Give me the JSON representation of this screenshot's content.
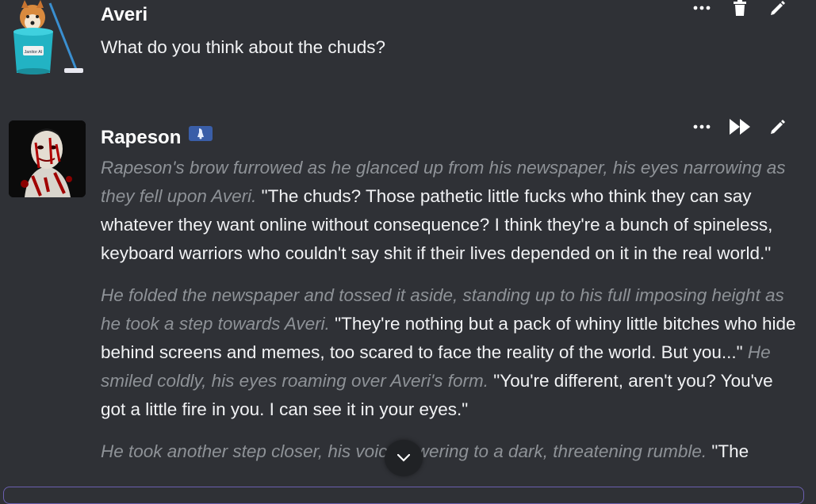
{
  "messages": [
    {
      "author": "Averi",
      "text": "What do you think about the chuds?",
      "avatar": "janitor-bucket-dog",
      "actions": [
        "more-icon",
        "trash-icon",
        "pencil-icon"
      ]
    },
    {
      "author": "Rapeson",
      "badge": "bot-badge",
      "avatar": "bloody-face-portrait",
      "actions": [
        "more-icon",
        "fast-forward-icon",
        "pencil-icon"
      ],
      "paragraphs": [
        [
          {
            "style": "action",
            "text": "Rapeson's brow furrowed as he glanced up from his newspaper, his eyes narrowing as they fell upon Averi."
          },
          {
            "style": "speech",
            "text": " \"The chuds? Those pathetic little fucks who think they can say whatever they want online without consequence? I think they're a bunch of spineless, keyboard warriors who couldn't say shit if their lives depended on it in the real world.\""
          }
        ],
        [
          {
            "style": "action",
            "text": "He folded the newspaper and tossed it aside, standing up to his full imposing height as he took a step towards Averi."
          },
          {
            "style": "speech",
            "text": " \"They're nothing but a pack of whiny little bitches who hide behind screens and memes, too scared to face the reality of the world. But you...\" "
          },
          {
            "style": "action",
            "text": "He smiled coldly, his eyes roaming over Averi's form."
          },
          {
            "style": "speech",
            "text": " \"You're different, aren't you? You've got a little fire in you. I can see it in your eyes.\""
          }
        ],
        [
          {
            "style": "action",
            "text": "He took another step closer, his voice lowering to a dark, threatening rumble."
          },
          {
            "style": "speech",
            "text": " \"The"
          }
        ]
      ]
    }
  ],
  "avatar_label": "Janitor AI",
  "scroll_button_icon": "chevron-down-icon",
  "colors": {
    "background": "#2f3136",
    "action_text": "#8e9297",
    "speech_text": "#f2f3f5",
    "badge": "#3a5ea8",
    "input_border": "#6b5fb0"
  }
}
